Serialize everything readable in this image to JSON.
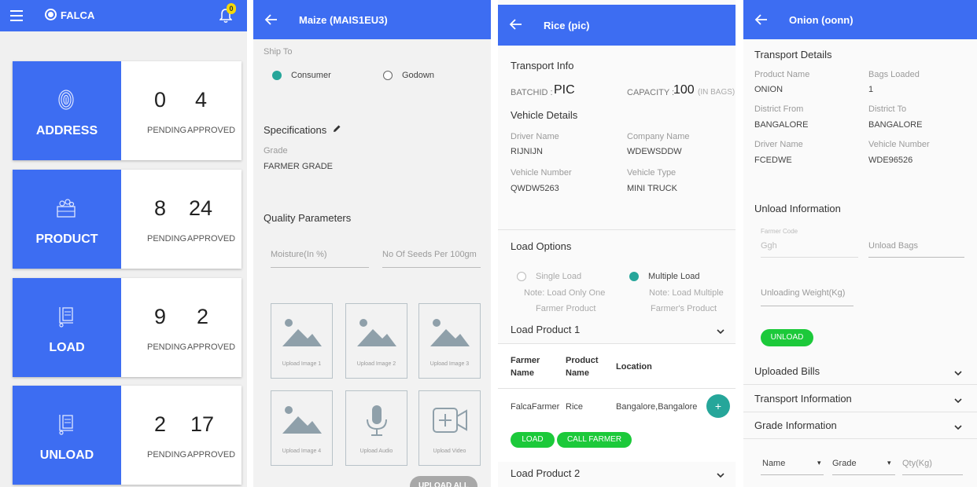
{
  "dashboard": {
    "brand": "FALCA",
    "notification_count": "0",
    "cards": [
      {
        "name": "ADDRESS",
        "pending": "0",
        "approved": "4",
        "pending_label": "PENDING",
        "approved_label": "APPROVED"
      },
      {
        "name": "PRODUCT",
        "pending": "8",
        "approved": "24",
        "pending_label": "PENDING",
        "approved_label": "APPROVED"
      },
      {
        "name": "LOAD",
        "pending": "9",
        "approved": "2",
        "pending_label": "PENDING",
        "approved_label": "APPROVED"
      },
      {
        "name": "UNLOAD",
        "pending": "2",
        "approved": "17",
        "pending_label": "PENDING",
        "approved_label": "APPROVED"
      }
    ],
    "colors": {
      "appbar": "#3d6df2",
      "card_blue": "#3d6df2"
    }
  },
  "product_screen": {
    "title": "Maize (MAIS1EU3)",
    "ship_to_label": "Ship To",
    "ship_options": [
      {
        "label": "Consumer",
        "selected": true
      },
      {
        "label": "Godown",
        "selected": false
      }
    ],
    "specifications_label": "Specifications",
    "grade_label": "Grade",
    "grade_value": "FARMER GRADE",
    "quality_label": "Quality Parameters",
    "moisture_placeholder": "Moisture(In %)",
    "seeds_placeholder": "No Of Seeds Per 100gm",
    "uploads": [
      {
        "label": "Upload Image 1",
        "icon": "image-icon"
      },
      {
        "label": "Upload Image 2",
        "icon": "image-icon"
      },
      {
        "label": "Upload Image 3",
        "icon": "image-icon"
      },
      {
        "label": "Upload Image 4",
        "icon": "image-icon"
      },
      {
        "label": "Upload Audio",
        "icon": "microphone-icon"
      },
      {
        "label": "Upload Video",
        "icon": "video-add-icon"
      }
    ],
    "upload_all": "UPLOAD ALL"
  },
  "load_screen": {
    "title": "Rice (pic)",
    "transport_info": "Transport Info",
    "batch_label": "BATCHID :",
    "batch_value": "PIC",
    "capacity_label": "CAPACITY :",
    "capacity_value": "100",
    "capacity_unit": "(IN BAGS)",
    "vehicle_details": "Vehicle Details",
    "driver_name_label": "Driver Name",
    "driver_name": "RIJNIJN",
    "company_name_label": "Company Name",
    "company_name": "WDEWSDDW",
    "vehicle_number_label": "Vehicle Number",
    "vehicle_number": "QWDW5263",
    "vehicle_type_label": "Vehicle Type",
    "vehicle_type": "MINI TRUCK",
    "load_options": "Load Options",
    "single_load": "Single Load",
    "single_note_1": "Note: Load Only One",
    "single_note_2": "Farmer Product",
    "multiple_load": "Multiple Load",
    "multiple_note_1": "Note: Load Multiple",
    "multiple_note_2": "Farmer's Product",
    "load_product_1": "Load Product 1",
    "col_farmer_1": "Farmer",
    "col_farmer_2": "Name",
    "col_product_1": "Product",
    "col_product_2": "Name",
    "col_location": "Location",
    "row": {
      "farmer": "FalcaFarmer",
      "product": "Rice",
      "location": "Bangalore,Bangalore"
    },
    "load_btn": "LOAD",
    "call_btn": "CALL FARMER",
    "load_product_2": "Load Product 2"
  },
  "unload_screen": {
    "title": "Onion (oonn)",
    "transport_details": "Transport Details",
    "product_name_label": "Product Name",
    "product_name": "ONION",
    "bags_loaded_label": "Bags Loaded",
    "bags_loaded": "1",
    "district_from_label": "District From",
    "district_from": "BANGALORE",
    "district_to_label": "District To",
    "district_to": "BANGALORE",
    "driver_name_label": "Driver Name",
    "driver_name": "FCEDWE",
    "vehicle_number_label": "Vehicle Number",
    "vehicle_number": "WDE96526",
    "unload_information": "Unload Information",
    "farmer_code_label": "Farmer Code",
    "farmer_code_value": "Ggh",
    "unload_bags_placeholder": "Unload Bags",
    "unloading_weight_placeholder": "Unloading Weight(Kg)",
    "unload_btn": "UNLOAD",
    "uploaded_bills": "Uploaded Bills",
    "transport_information": "Transport Information",
    "grade_information": "Grade Information",
    "name_select": "Name",
    "grade_select": "Grade",
    "qty_placeholder": "Qty(Kg)"
  }
}
